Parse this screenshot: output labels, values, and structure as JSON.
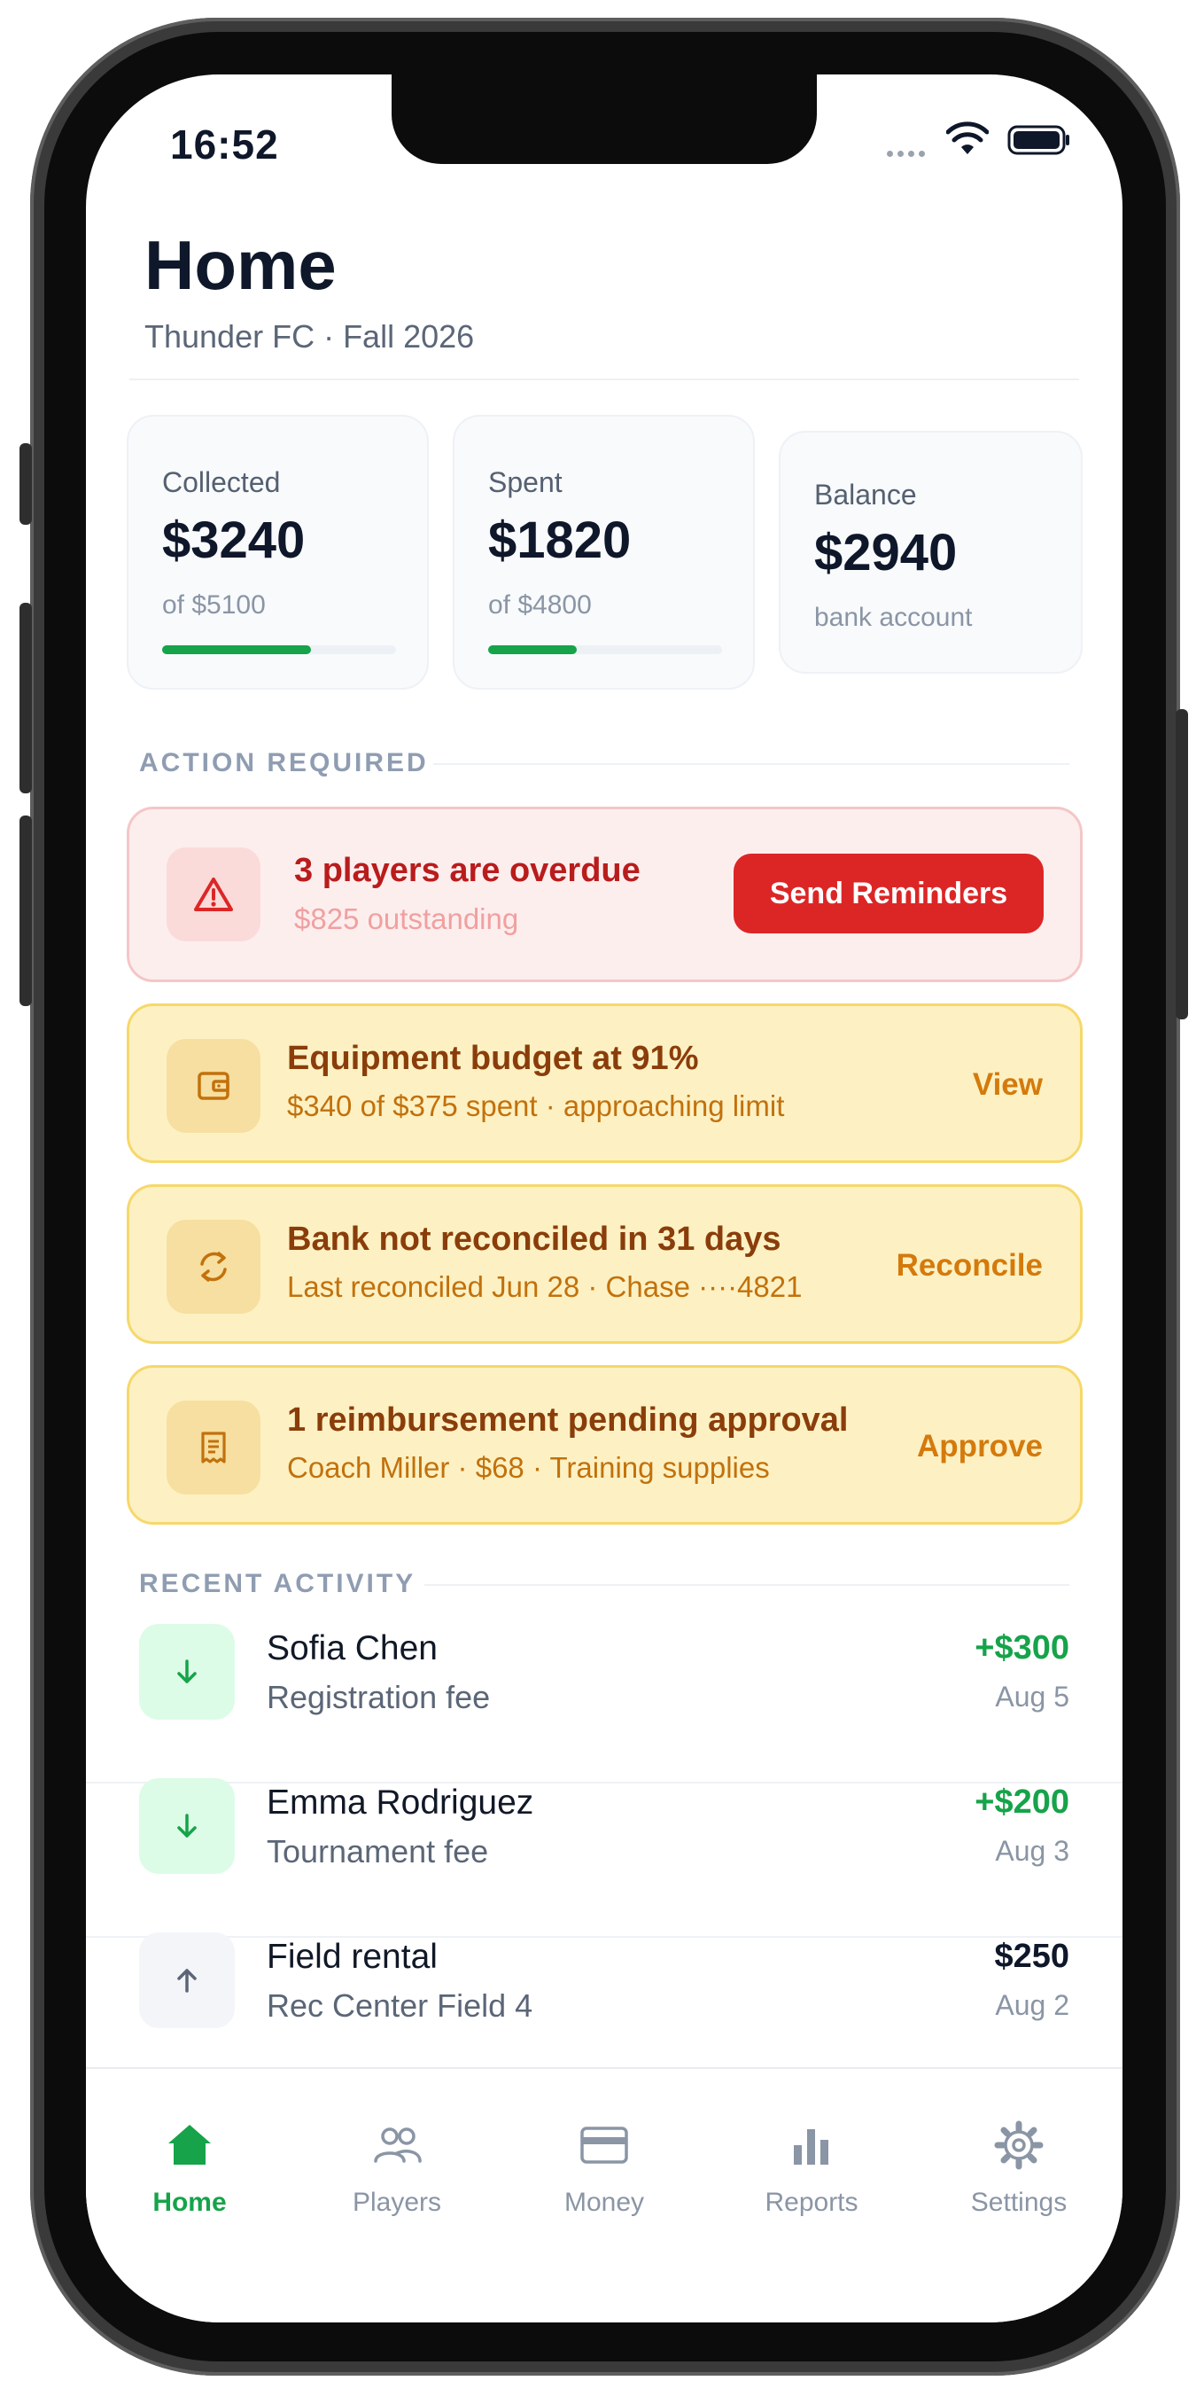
{
  "status_bar": {
    "time": "16:52"
  },
  "header": {
    "title": "Home",
    "subtitle": "Thunder FC · Fall 2026"
  },
  "stats": [
    {
      "label": "Collected",
      "value": "$3240",
      "sub": "of $5100",
      "progress": 0.635,
      "progress_color": "#16a34a"
    },
    {
      "label": "Spent",
      "value": "$1820",
      "sub": "of $4800",
      "progress": 0.379,
      "progress_color": "#16a34a"
    },
    {
      "label": "Balance",
      "value": "$2940",
      "sub": "bank account"
    }
  ],
  "action_required": {
    "heading": "ACTION REQUIRED",
    "alerts": [
      {
        "icon": "warning-triangle-icon",
        "title": "3 players are overdue",
        "subtitle": "$825 outstanding",
        "action": "Send Reminders",
        "tone": "red"
      },
      {
        "icon": "wallet-icon",
        "title": "Equipment budget at 91%",
        "subtitle": "$340 of $375 spent · approaching limit",
        "action": "View",
        "tone": "amber"
      },
      {
        "icon": "sync-icon",
        "title": "Bank not reconciled in 31 days",
        "subtitle": "Last reconciled Jun 28 · Chase ····4821",
        "action": "Reconcile",
        "tone": "amber"
      },
      {
        "icon": "receipt-icon",
        "title": "1 reimbursement pending approval",
        "subtitle": "Coach Miller · $68 · Training supplies",
        "action": "Approve",
        "tone": "amber"
      }
    ]
  },
  "recent_activity": {
    "heading": "RECENT ACTIVITY",
    "items": [
      {
        "icon": "arrow-down-icon",
        "name": "Sofia Chen",
        "description": "Registration fee",
        "amount": "+$300",
        "date": "Aug 5",
        "direction": "in"
      },
      {
        "icon": "arrow-down-icon",
        "name": "Emma Rodriguez",
        "description": "Tournament fee",
        "amount": "+$200",
        "date": "Aug 3",
        "direction": "in"
      },
      {
        "icon": "arrow-up-icon",
        "name": "Field rental",
        "description": "Rec Center Field 4",
        "amount": "$250",
        "date": "Aug 2",
        "direction": "out"
      }
    ]
  },
  "tabs": [
    {
      "label": "Home",
      "icon": "home-icon",
      "active": true
    },
    {
      "label": "Players",
      "icon": "players-icon",
      "active": false
    },
    {
      "label": "Money",
      "icon": "card-icon",
      "active": false
    },
    {
      "label": "Reports",
      "icon": "bar-chart-icon",
      "active": false
    },
    {
      "label": "Settings",
      "icon": "gear-icon",
      "active": false
    }
  ],
  "colors": {
    "accent_green": "#16a34a",
    "danger_red": "#dc2626",
    "warning_amber": "#d47a0c",
    "text_dark": "#0f172a"
  }
}
